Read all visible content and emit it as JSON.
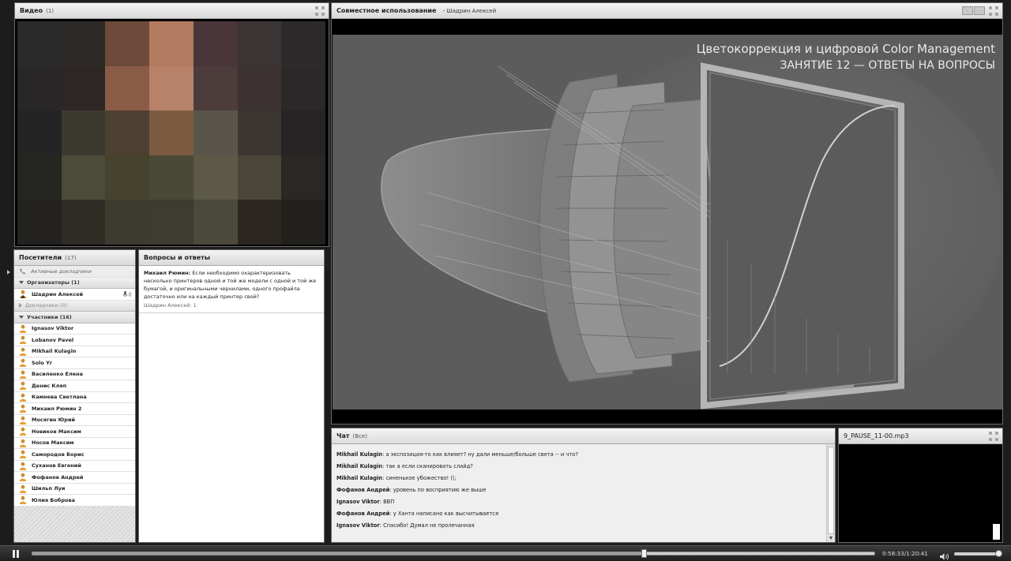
{
  "video_pod": {
    "title": "Видео",
    "count": "(1)",
    "pixel_colors": [
      "#2a2a2a",
      "#2d2a28",
      "#6e4a3a",
      "#b27a5e",
      "#4a3538",
      "#3a3434",
      "#2c2a2a",
      "#282626",
      "#2e2624",
      "#8a5c48",
      "#b8816a",
      "#4d3c3c",
      "#3c3232",
      "#2a2828",
      "#242424",
      "#3c3a30",
      "#4c4030",
      "#7c5a42",
      "#5a554a",
      "#3b3632",
      "#262424",
      "#252521",
      "#4c4a38",
      "#45432e",
      "#4a4836",
      "#5c5a46",
      "#4a473a",
      "#2a2824",
      "#242220",
      "#2e2c25",
      "#3d3b30",
      "#3e3b31",
      "#4b493b",
      "#2c2620",
      "#22201d"
    ]
  },
  "share_pod": {
    "title": "Совместное использование",
    "presenter": "- Шадрин Алексей",
    "slide_title_line1": "Цветокоррекция и цифровой Color Management",
    "slide_title_line2": "ЗАНЯТИЕ 12 — ОТВЕТЫ НА ВОПРОСЫ"
  },
  "attendees": {
    "title": "Посетители",
    "count": "(17)",
    "active_speakers": "Активные докладчики",
    "organizers_label": "Организаторы (1)",
    "host": "Шадрин Алексей",
    "speakers_label": "Докладчики (0)",
    "participants_label": "Участники (16)",
    "participants": [
      "Ignasov Viktor",
      "Lobanov Pavel",
      "Mikhail Kulagin",
      "Solo Yr",
      "Василенко Елена",
      "Денис Кляп",
      "Камнева Светлана",
      "Михаил Рюмин 2",
      "Мосягин Юрий",
      "Новиков Максим",
      "Носов Максим",
      "Самородов Борис",
      "Суханов Евгений",
      "Фофанов Андрей",
      "Шильп Луи",
      "Юлия Боброва"
    ]
  },
  "qa": {
    "title": "Вопросы и ответы",
    "question_author": "Михаил Рюмин:",
    "question_text": "Если необходимо охарактеризовать несколько принтеров одной и той же модели с одной и той же бумагой, и оригинальными чернилами, одного профайла достаточно или на каждый принтер свой?",
    "answered_by": "Шадрин Алексей: 1"
  },
  "chat": {
    "title": "Чат",
    "scope": "(Все)",
    "messages": [
      {
        "who": "Mikhail Kulagin",
        "text": ": а экспозиция-то как влияет? ну дали меньше/больше света -- и что?"
      },
      {
        "who": "Mikhail Kulagin",
        "text": ": так а если сканировать слайд?"
      },
      {
        "who": "Mikhail Kulagin",
        "text": ": синенькое убожество! ((;"
      },
      {
        "who": "Фофанов Андрей",
        "text": ": уровень по восприятию же выше"
      },
      {
        "who": "Ignasov Viktor",
        "text": ": ВВП"
      },
      {
        "who": "Фофанов Андрей",
        "text": ": у Ханта написано как высчитывается"
      },
      {
        "who": "Ignasov Viktor",
        "text": ": Спасибо! Думал не пролечанная"
      }
    ]
  },
  "media_pod": {
    "title": "9_PAUSE_11-00.mp3"
  },
  "playback": {
    "time": "0:58:33/1:20:41",
    "progress": 0.7257,
    "volume": 1.0
  },
  "colors": {
    "accent_person": "#e4a13a",
    "share_bg": "#5d5d5d"
  }
}
